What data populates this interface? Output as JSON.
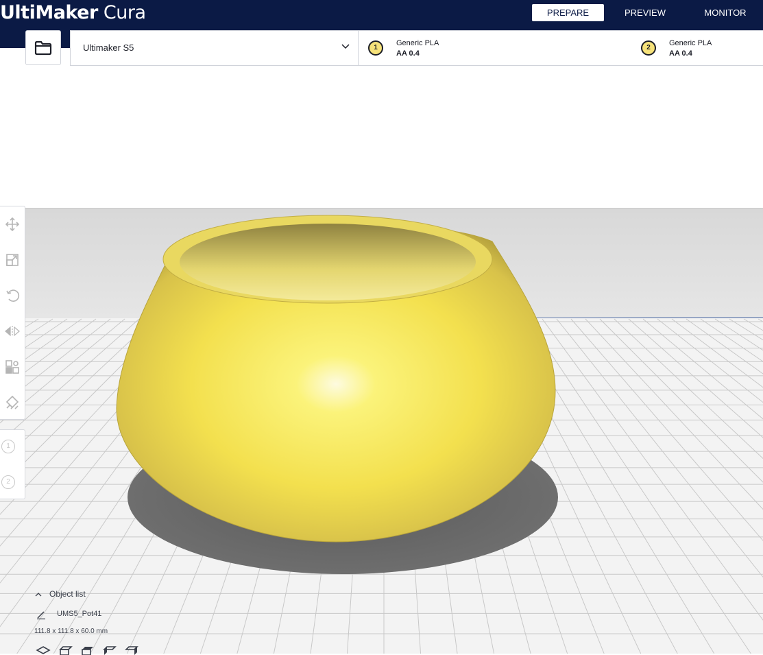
{
  "app": {
    "brand": "UltiMaker",
    "product": "Cura"
  },
  "nav": {
    "tabs": [
      "PREPARE",
      "PREVIEW",
      "MONITOR"
    ],
    "active": "PREPARE"
  },
  "toolbar": {
    "open_icon": "folder-icon",
    "printer": "Ultimaker S5",
    "extruders": [
      {
        "index": "1",
        "material": "Generic PLA",
        "nozzle": "AA 0.4"
      },
      {
        "index": "2",
        "material": "Generic PLA",
        "nozzle": "AA 0.4"
      }
    ]
  },
  "tools": [
    "move-icon",
    "scale-icon",
    "rotate-icon",
    "mirror-icon",
    "per-model-settings-icon",
    "support-blocker-icon"
  ],
  "extruder_tools": [
    "1",
    "2"
  ],
  "object_list": {
    "toggle_label": "Object list",
    "object_name": "UMS5_Pot41",
    "dimensions": "111.8 x 111.8 x 60.0 mm"
  },
  "colors": {
    "header": "#0b1a45",
    "model_yellow": "#f6e650",
    "extruder_badge": "#f6e27a",
    "build_plate": "#f3f3f3",
    "grid": "#c8c8c8"
  }
}
